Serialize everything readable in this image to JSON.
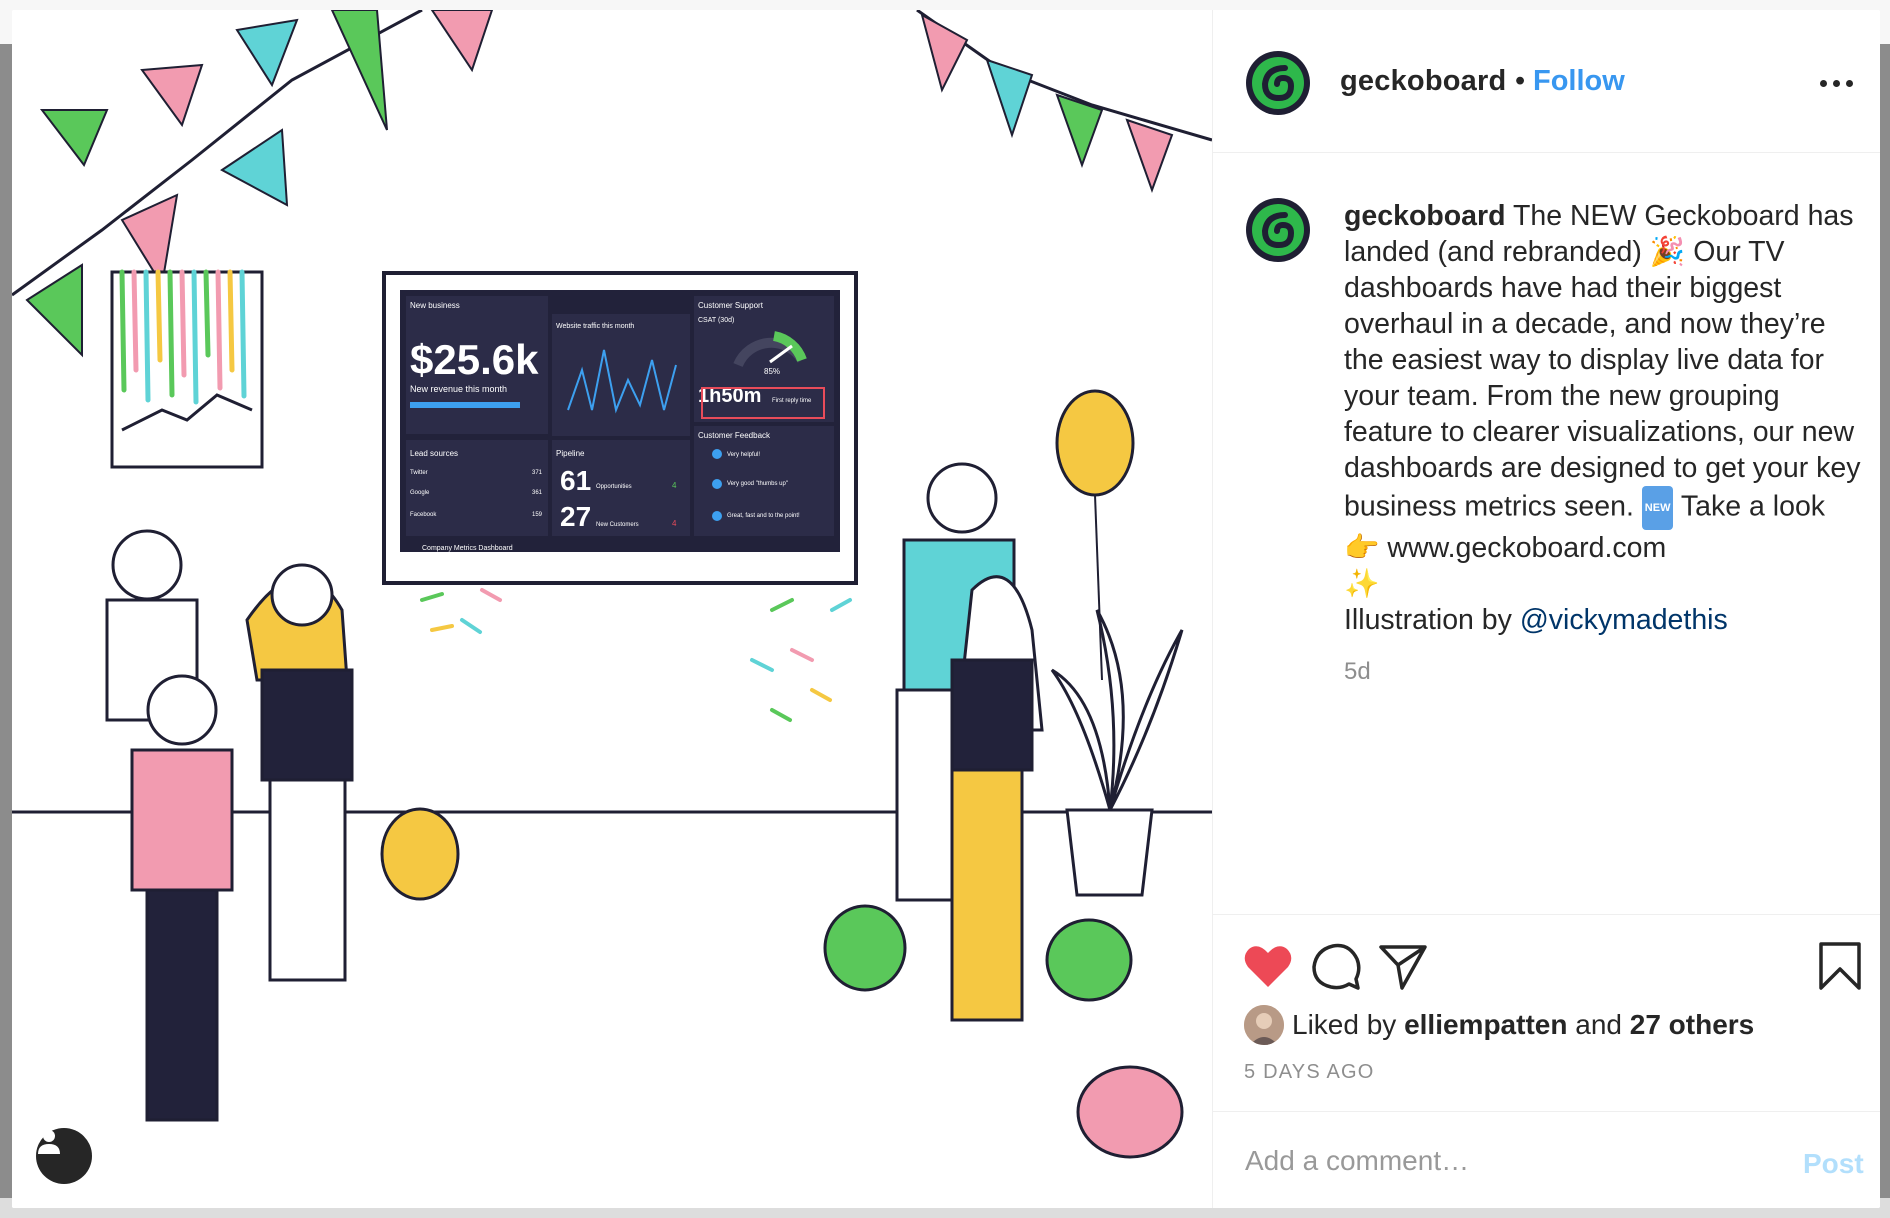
{
  "post": {
    "username": "geckoboard",
    "separator": "•",
    "follow_label": "Follow",
    "caption_user": "geckoboard",
    "caption_line1": " The NEW Geckoboard has landed (and rebranded) 🎉  Our TV dashboards have had their biggest overhaul in a decade, and now they’re the easiest way to display live data for your team. From the new grouping feature to clearer visualizations, our new dashboards are designed to get your key business metrics seen. ",
    "new_badge": "NEW",
    "caption_line2": "  Take a look",
    "caption_line3": "👉  www.geckoboard.com",
    "caption_line4": "✨",
    "illustration_prefix": "Illustration by ",
    "illustration_handle": "@vickymadethis",
    "age": "5d",
    "liked_by_prefix": "Liked by ",
    "liked_by_user": "elliempatten",
    "liked_by_mid": " and ",
    "liked_by_others": "27 others",
    "timestamp": "5 DAYS AGO",
    "comment_placeholder": "Add a comment…",
    "post_button": "Post"
  },
  "dashboard": {
    "new_business_title": "New business",
    "revenue_value": "$25.6k",
    "revenue_label": "New revenue this month",
    "traffic_title": "Website traffic this month",
    "support_title": "Customer Support",
    "csat_label": "CSAT (30d)",
    "csat_value": "85%",
    "reply_time_value": "1h50m",
    "reply_time_label": "First reply time",
    "feedback_title": "Customer Feedback",
    "feedback_items": [
      "Very helpful!",
      "Very good \"thumbs up\"",
      "Great, fast and to the point!"
    ],
    "lead_title": "Lead sources",
    "lead_rows": [
      {
        "name": "Twitter",
        "value": "371"
      },
      {
        "name": "Google",
        "value": "361"
      },
      {
        "name": "Facebook",
        "value": "159"
      }
    ],
    "pipeline_title": "Pipeline",
    "opportunities_value": "61",
    "opportunities_label": "Opportunities",
    "opportunities_delta": "4",
    "customers_value": "27",
    "customers_label": "New Customers",
    "customers_delta": "4",
    "footer_label": "Company Metrics Dashboard"
  },
  "colors": {
    "like_red": "#ed4956",
    "link_blue": "#3897f0",
    "post_disabled": "#b2dffc",
    "gecko_green": "#2eb84b",
    "dashboard_bg": "#22223a"
  },
  "icons": [
    "heart-icon",
    "comment-icon",
    "share-icon",
    "bookmark-icon",
    "more-icon",
    "person-icon"
  ]
}
